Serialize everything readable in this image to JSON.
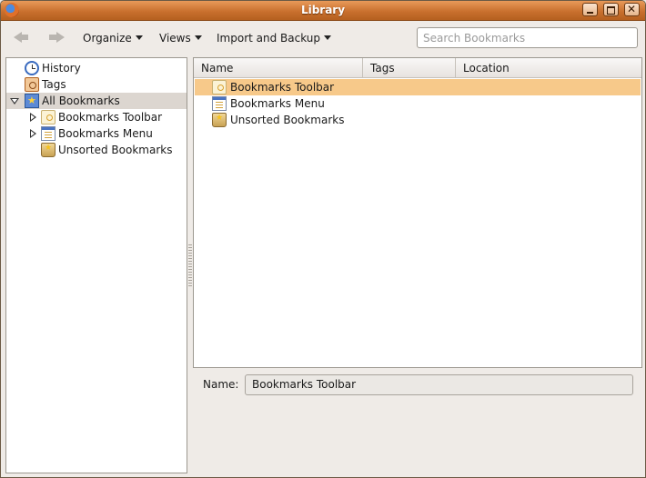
{
  "window": {
    "title": "Library",
    "accent_color": "#c9702e",
    "selection_color": "#f7c98a"
  },
  "toolbar": {
    "back_icon": "back-arrow-icon",
    "forward_icon": "forward-arrow-icon",
    "organize_label": "Organize",
    "views_label": "Views",
    "import_label": "Import and Backup",
    "search_placeholder": "Search Bookmarks",
    "search_value": ""
  },
  "sidebar": {
    "items": [
      {
        "label": "History",
        "icon": "history-clock-icon",
        "level": 0,
        "expander": "none",
        "selected": false
      },
      {
        "label": "Tags",
        "icon": "tags-icon",
        "level": 0,
        "expander": "none",
        "selected": false
      },
      {
        "label": "All Bookmarks",
        "icon": "all-bookmarks-star-icon",
        "level": 0,
        "expander": "expanded",
        "selected": true
      },
      {
        "label": "Bookmarks Toolbar",
        "icon": "bookmarks-toolbar-icon",
        "level": 1,
        "expander": "collapsed",
        "selected": false
      },
      {
        "label": "Bookmarks Menu",
        "icon": "bookmarks-menu-icon",
        "level": 1,
        "expander": "collapsed",
        "selected": false
      },
      {
        "label": "Unsorted Bookmarks",
        "icon": "unsorted-bookmarks-icon",
        "level": 1,
        "expander": "none",
        "selected": false
      }
    ]
  },
  "list": {
    "columns": [
      "Name",
      "Tags",
      "Location"
    ],
    "rows": [
      {
        "name": "Bookmarks Toolbar",
        "icon": "bookmarks-toolbar-icon",
        "selected": true
      },
      {
        "name": "Bookmarks Menu",
        "icon": "bookmarks-menu-icon",
        "selected": false
      },
      {
        "name": "Unsorted Bookmarks",
        "icon": "unsorted-bookmarks-icon",
        "selected": false
      }
    ]
  },
  "details": {
    "name_label": "Name:",
    "name_value": "Bookmarks Toolbar"
  }
}
